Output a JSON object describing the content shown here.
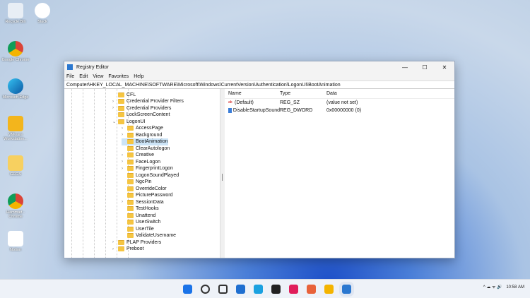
{
  "desktop": [
    {
      "label": "Recycle Bin",
      "icon": "recycle-bin-icon"
    },
    {
      "label": "Slack",
      "icon": "slack-icon"
    },
    {
      "label": "Google Chrome",
      "icon": "chrome-icon"
    },
    {
      "label": "Microsoft Edge",
      "icon": "edge-icon"
    },
    {
      "label": "VMware Workstation...",
      "icon": "vmware-icon"
    },
    {
      "label": "GEGS",
      "icon": "folder-icon"
    },
    {
      "label": "Hammad - Chrome",
      "icon": "chrome-profile-icon"
    },
    {
      "label": "Notion",
      "icon": "notion-icon"
    }
  ],
  "window": {
    "title": "Registry Editor",
    "minimize": "—",
    "maximize": "☐",
    "close": "✕"
  },
  "menu": [
    "File",
    "Edit",
    "View",
    "Favorites",
    "Help"
  ],
  "address": "Computer\\HKEY_LOCAL_MACHINE\\SOFTWARE\\Microsoft\\Windows\\CurrentVersion\\Authentication\\LogonUI\\BootAnimation",
  "tree": [
    {
      "label": "CFL",
      "level": 0,
      "arrow": ""
    },
    {
      "label": "Credential Provider Filters",
      "level": 0,
      "arrow": "›"
    },
    {
      "label": "Credential Providers",
      "level": 0,
      "arrow": "›"
    },
    {
      "label": "LockScreenContent",
      "level": 0,
      "arrow": ""
    },
    {
      "label": "LogonUI",
      "level": 0,
      "arrow": "⌄"
    },
    {
      "label": "AccessPage",
      "level": 1,
      "arrow": "›"
    },
    {
      "label": "Background",
      "level": 1,
      "arrow": "›"
    },
    {
      "label": "BootAnimation",
      "level": 1,
      "arrow": "",
      "selected": true
    },
    {
      "label": "ClearAutologon",
      "level": 1,
      "arrow": ""
    },
    {
      "label": "Creative",
      "level": 1,
      "arrow": "›"
    },
    {
      "label": "FaceLogon",
      "level": 1,
      "arrow": "›"
    },
    {
      "label": "FingerprintLogon",
      "level": 1,
      "arrow": "›"
    },
    {
      "label": "LogonSoundPlayed",
      "level": 1,
      "arrow": ""
    },
    {
      "label": "NgcPin",
      "level": 1,
      "arrow": ""
    },
    {
      "label": "OverrideColor",
      "level": 1,
      "arrow": ""
    },
    {
      "label": "PicturePassword",
      "level": 1,
      "arrow": ""
    },
    {
      "label": "SessionData",
      "level": 1,
      "arrow": "›"
    },
    {
      "label": "TestHooks",
      "level": 1,
      "arrow": ""
    },
    {
      "label": "Unattend",
      "level": 1,
      "arrow": ""
    },
    {
      "label": "UserSwitch",
      "level": 1,
      "arrow": ""
    },
    {
      "label": "UserTile",
      "level": 1,
      "arrow": ""
    },
    {
      "label": "ValidateUsername",
      "level": 1,
      "arrow": ""
    },
    {
      "label": "PLAP Providers",
      "level": 0,
      "arrow": "›"
    },
    {
      "label": "Preboot",
      "level": 0,
      "arrow": "›"
    }
  ],
  "columns": {
    "name": "Name",
    "type": "Type",
    "data": "Data"
  },
  "values": [
    {
      "name": "(Default)",
      "type": "REG_SZ",
      "data": "(value not set)",
      "icon": "ab"
    },
    {
      "name": "DisableStartupSound",
      "type": "REG_DWORD",
      "data": "0x00000000 (0)",
      "icon": "dword"
    }
  ],
  "taskbar": {
    "items": [
      "start",
      "search",
      "task-view",
      "widgets",
      "edge",
      "notion",
      "slack",
      "paint",
      "chrome",
      "registry"
    ],
    "time": "10:58 AM",
    "tray": "^ ☁ ᯤ 🔊"
  }
}
